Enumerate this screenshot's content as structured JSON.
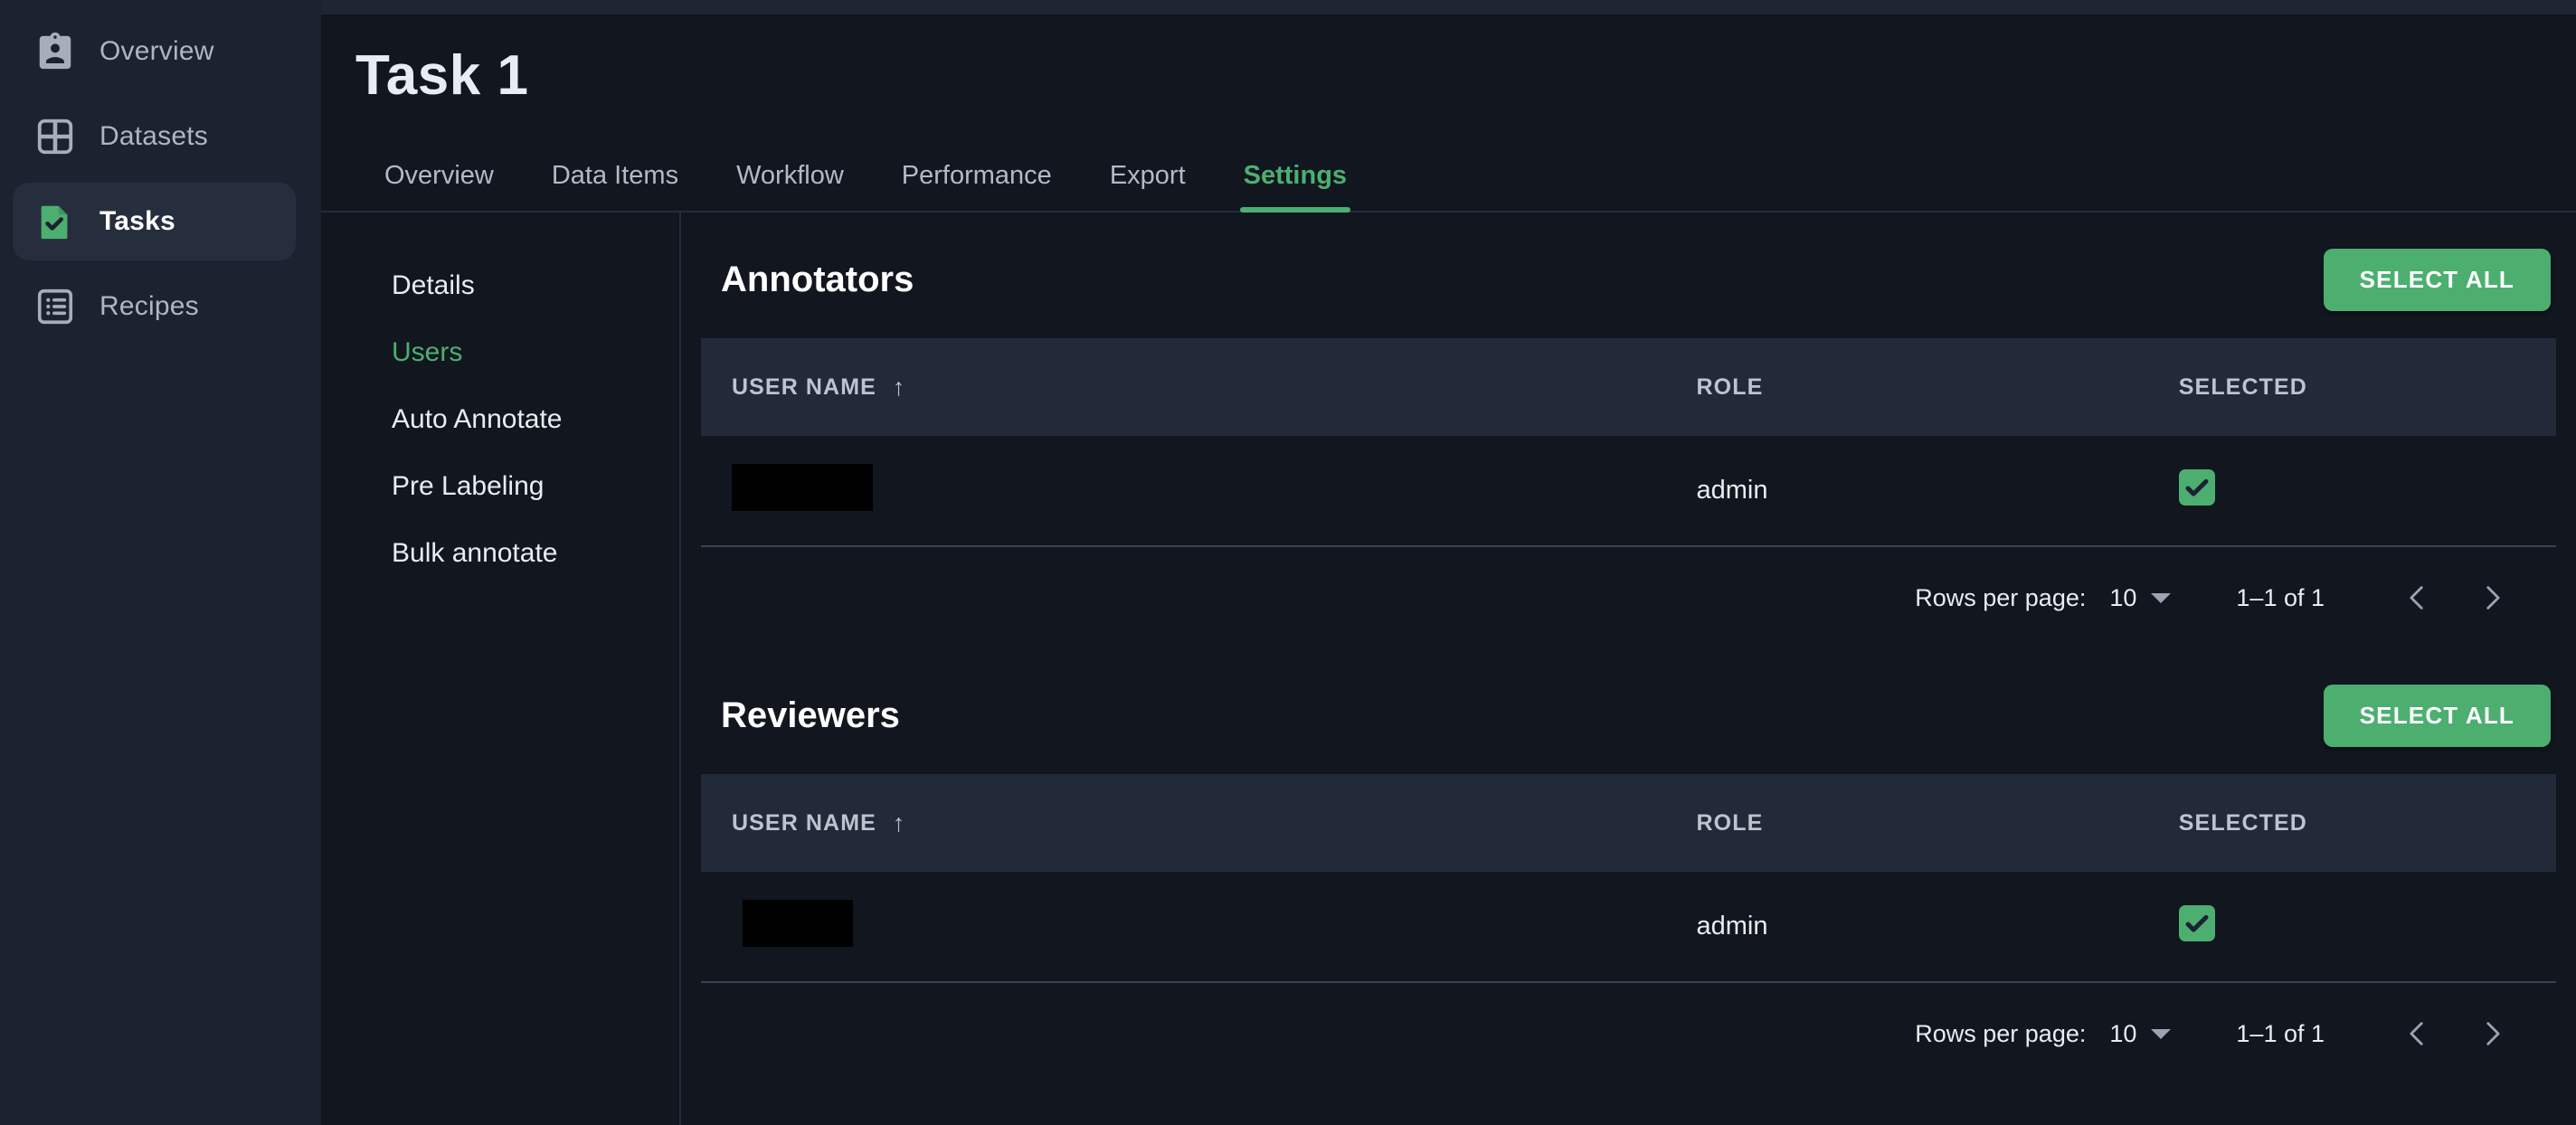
{
  "sidebar": {
    "items": [
      {
        "label": "Overview",
        "icon": "badge-icon",
        "active": false
      },
      {
        "label": "Datasets",
        "icon": "grid-icon",
        "active": false
      },
      {
        "label": "Tasks",
        "icon": "document-check-icon",
        "active": true
      },
      {
        "label": "Recipes",
        "icon": "list-icon",
        "active": false
      }
    ]
  },
  "header": {
    "title": "Task 1"
  },
  "tabs": [
    {
      "label": "Overview"
    },
    {
      "label": "Data Items"
    },
    {
      "label": "Workflow"
    },
    {
      "label": "Performance"
    },
    {
      "label": "Export"
    },
    {
      "label": "Settings"
    }
  ],
  "subnav": [
    {
      "label": "Details"
    },
    {
      "label": "Users"
    },
    {
      "label": "Auto Annotate"
    },
    {
      "label": "Pre Labeling"
    },
    {
      "label": "Bulk annotate"
    }
  ],
  "sections": [
    {
      "title": "Annotators",
      "select_all_label": "SELECT ALL",
      "columns": [
        "USER NAME",
        "ROLE",
        "SELECTED"
      ],
      "sort_column": "USER NAME",
      "sort_direction": "ascending",
      "sort_glyph": "↑",
      "rows": [
        {
          "user_name": "",
          "user_name_redacted": true,
          "role": "admin",
          "selected": true
        }
      ],
      "pagination": {
        "rows_per_page_label": "Rows per page:",
        "rows_per_page_value": "10",
        "range": "1–1 of 1"
      }
    },
    {
      "title": "Reviewers",
      "select_all_label": "SELECT ALL",
      "columns": [
        "USER NAME",
        "ROLE",
        "SELECTED"
      ],
      "sort_column": "USER NAME",
      "sort_direction": "ascending",
      "sort_glyph": "↑",
      "rows": [
        {
          "user_name": "",
          "user_name_redacted": true,
          "role": "admin",
          "selected": true
        }
      ],
      "pagination": {
        "rows_per_page_label": "Rows per page:",
        "rows_per_page_value": "10",
        "range": "1–1 of 1"
      }
    }
  ],
  "colors": {
    "accent_green": "#4caf70",
    "rail_bg": "#1b2230",
    "main_bg": "#11161f",
    "table_header_bg": "#222a3a",
    "text_primary": "#e8ecf3",
    "text_muted": "#b3bac6"
  }
}
